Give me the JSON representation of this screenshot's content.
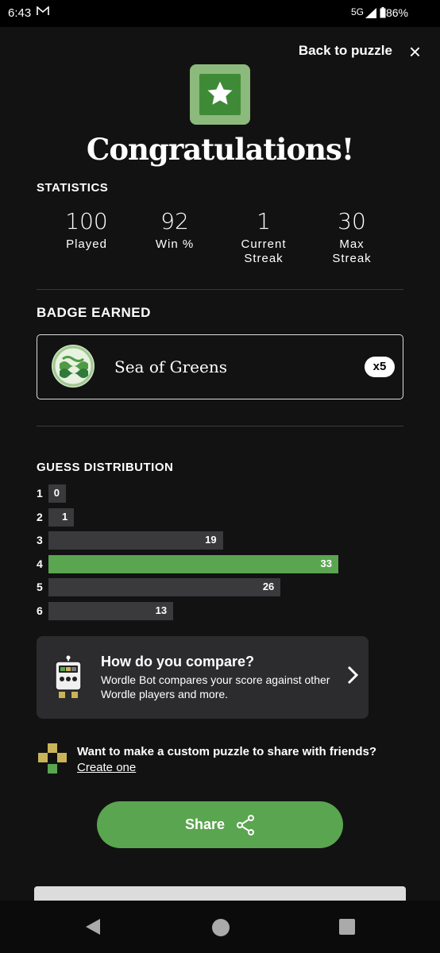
{
  "status_bar": {
    "time": "6:43",
    "network": "5G",
    "battery": "86%"
  },
  "header": {
    "back_label": "Back to puzzle",
    "close_icon": "×"
  },
  "congrats": {
    "title": "Congratulations!"
  },
  "statistics": {
    "title": "STATISTICS",
    "items": [
      {
        "value": "100",
        "label": "Played"
      },
      {
        "value": "92",
        "label": "Win %"
      },
      {
        "value": "1",
        "label": "Current Streak"
      },
      {
        "value": "30",
        "label": "Max Streak"
      }
    ]
  },
  "badge": {
    "title": "BADGE EARNED",
    "name": "Sea of Greens",
    "count": "x5"
  },
  "distribution": {
    "title": "GUESS DISTRIBUTION",
    "rows": [
      {
        "guess": "1",
        "count": "0",
        "fraction": 0.0
      },
      {
        "guess": "2",
        "count": "1",
        "fraction": 0.03
      },
      {
        "guess": "3",
        "count": "19",
        "fraction": 0.576
      },
      {
        "guess": "4",
        "count": "33",
        "fraction": 1.0,
        "highlight": true
      },
      {
        "guess": "5",
        "count": "26",
        "fraction": 0.788
      },
      {
        "guess": "6",
        "count": "13",
        "fraction": 0.394
      }
    ]
  },
  "compare": {
    "title": "How do you compare?",
    "description": "Wordle Bot compares your score against other Wordle players and more."
  },
  "custom_puzzle": {
    "question": "Want to make a custom puzzle to share with friends?",
    "link": "Create one"
  },
  "share": {
    "label": "Share"
  },
  "colors": {
    "accent_green": "#5aa550",
    "background": "#121213",
    "bar": "#3a3a3c"
  }
}
